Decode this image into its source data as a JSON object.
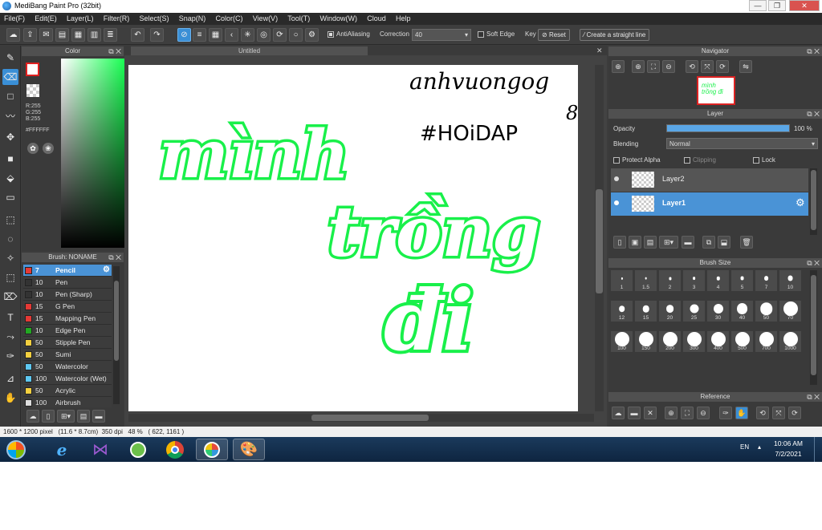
{
  "window": {
    "title": "MediBang Paint Pro (32bit)",
    "minimize": "—",
    "restore": "❐",
    "close": "✕"
  },
  "menu": [
    "File(F)",
    "Edit(E)",
    "Layer(L)",
    "Filter(R)",
    "Select(S)",
    "Snap(N)",
    "Color(C)",
    "View(V)",
    "Tool(T)",
    "Window(W)",
    "Cloud",
    "Help"
  ],
  "toolbar": {
    "antialiasing": "AntiAliasing",
    "correction_label": "Correction",
    "correction_value": "40",
    "soft_edge": "Soft Edge",
    "key": "Key",
    "reset": "Reset",
    "straight_line": "Create a straight line"
  },
  "color_panel": {
    "title": "Color",
    "r": "R:255",
    "g": "G:255",
    "b": "B:255",
    "hex": "#FFFFFF"
  },
  "brush_panel": {
    "title": "Brush: NONAME",
    "brushes": [
      {
        "size": "7",
        "name": "Pencil",
        "color": "#e53935"
      },
      {
        "size": "10",
        "name": "Pen",
        "color": "#333333"
      },
      {
        "size": "10",
        "name": "Pen (Sharp)",
        "color": "#333333"
      },
      {
        "size": "15",
        "name": "G Pen",
        "color": "#e53935"
      },
      {
        "size": "15",
        "name": "Mapping Pen",
        "color": "#e53935"
      },
      {
        "size": "10",
        "name": "Edge Pen",
        "color": "#22a822"
      },
      {
        "size": "50",
        "name": "Stipple Pen",
        "color": "#f4d03f"
      },
      {
        "size": "50",
        "name": "Sumi",
        "color": "#f4d03f"
      },
      {
        "size": "50",
        "name": "Watercolor",
        "color": "#5ec8f2"
      },
      {
        "size": "100",
        "name": "Watercolor (Wet)",
        "color": "#5ec8f2"
      },
      {
        "size": "50",
        "name": "Acrylic",
        "color": "#f4d03f"
      },
      {
        "size": "100",
        "name": "Airbrush",
        "color": "#dddddd"
      }
    ]
  },
  "canvas": {
    "tab_title": "Untitled",
    "text_top_right": "anhvuongog",
    "text_top_right_2": "8",
    "hashtag": "#HOiDAP",
    "word1": "mình",
    "word2": "trồng",
    "word3": "đi",
    "ink_color": "#19f04a"
  },
  "navigator": {
    "title": "Navigator"
  },
  "layer_panel": {
    "title": "Layer",
    "opacity_label": "Opacity",
    "opacity_value": "100 %",
    "opacity_level": 1.0,
    "blending_label": "Blending",
    "blending_value": "Normal",
    "protect_alpha": "Protect Alpha",
    "clipping": "Clipping",
    "lock": "Lock",
    "layers": [
      {
        "name": "Layer2",
        "selected": false
      },
      {
        "name": "Layer1",
        "selected": true
      }
    ]
  },
  "brush_size_panel": {
    "title": "Brush Size",
    "sizes": [
      "1",
      "1.5",
      "2",
      "3",
      "4",
      "5",
      "7",
      "10",
      "12",
      "15",
      "20",
      "25",
      "30",
      "40",
      "50",
      "70",
      "100",
      "150",
      "200",
      "300",
      "400",
      "500",
      "700",
      "1000"
    ]
  },
  "reference_panel": {
    "title": "Reference"
  },
  "status": {
    "dims": "1600 * 1200 pixel",
    "cm": "(11.6 * 8.7cm)",
    "dpi": "350 dpi",
    "zoom": "48 %",
    "coords": "( 622, 1161 )"
  },
  "taskbar": {
    "lang": "EN",
    "time": "10:06 AM",
    "date": "7/2/2021"
  }
}
